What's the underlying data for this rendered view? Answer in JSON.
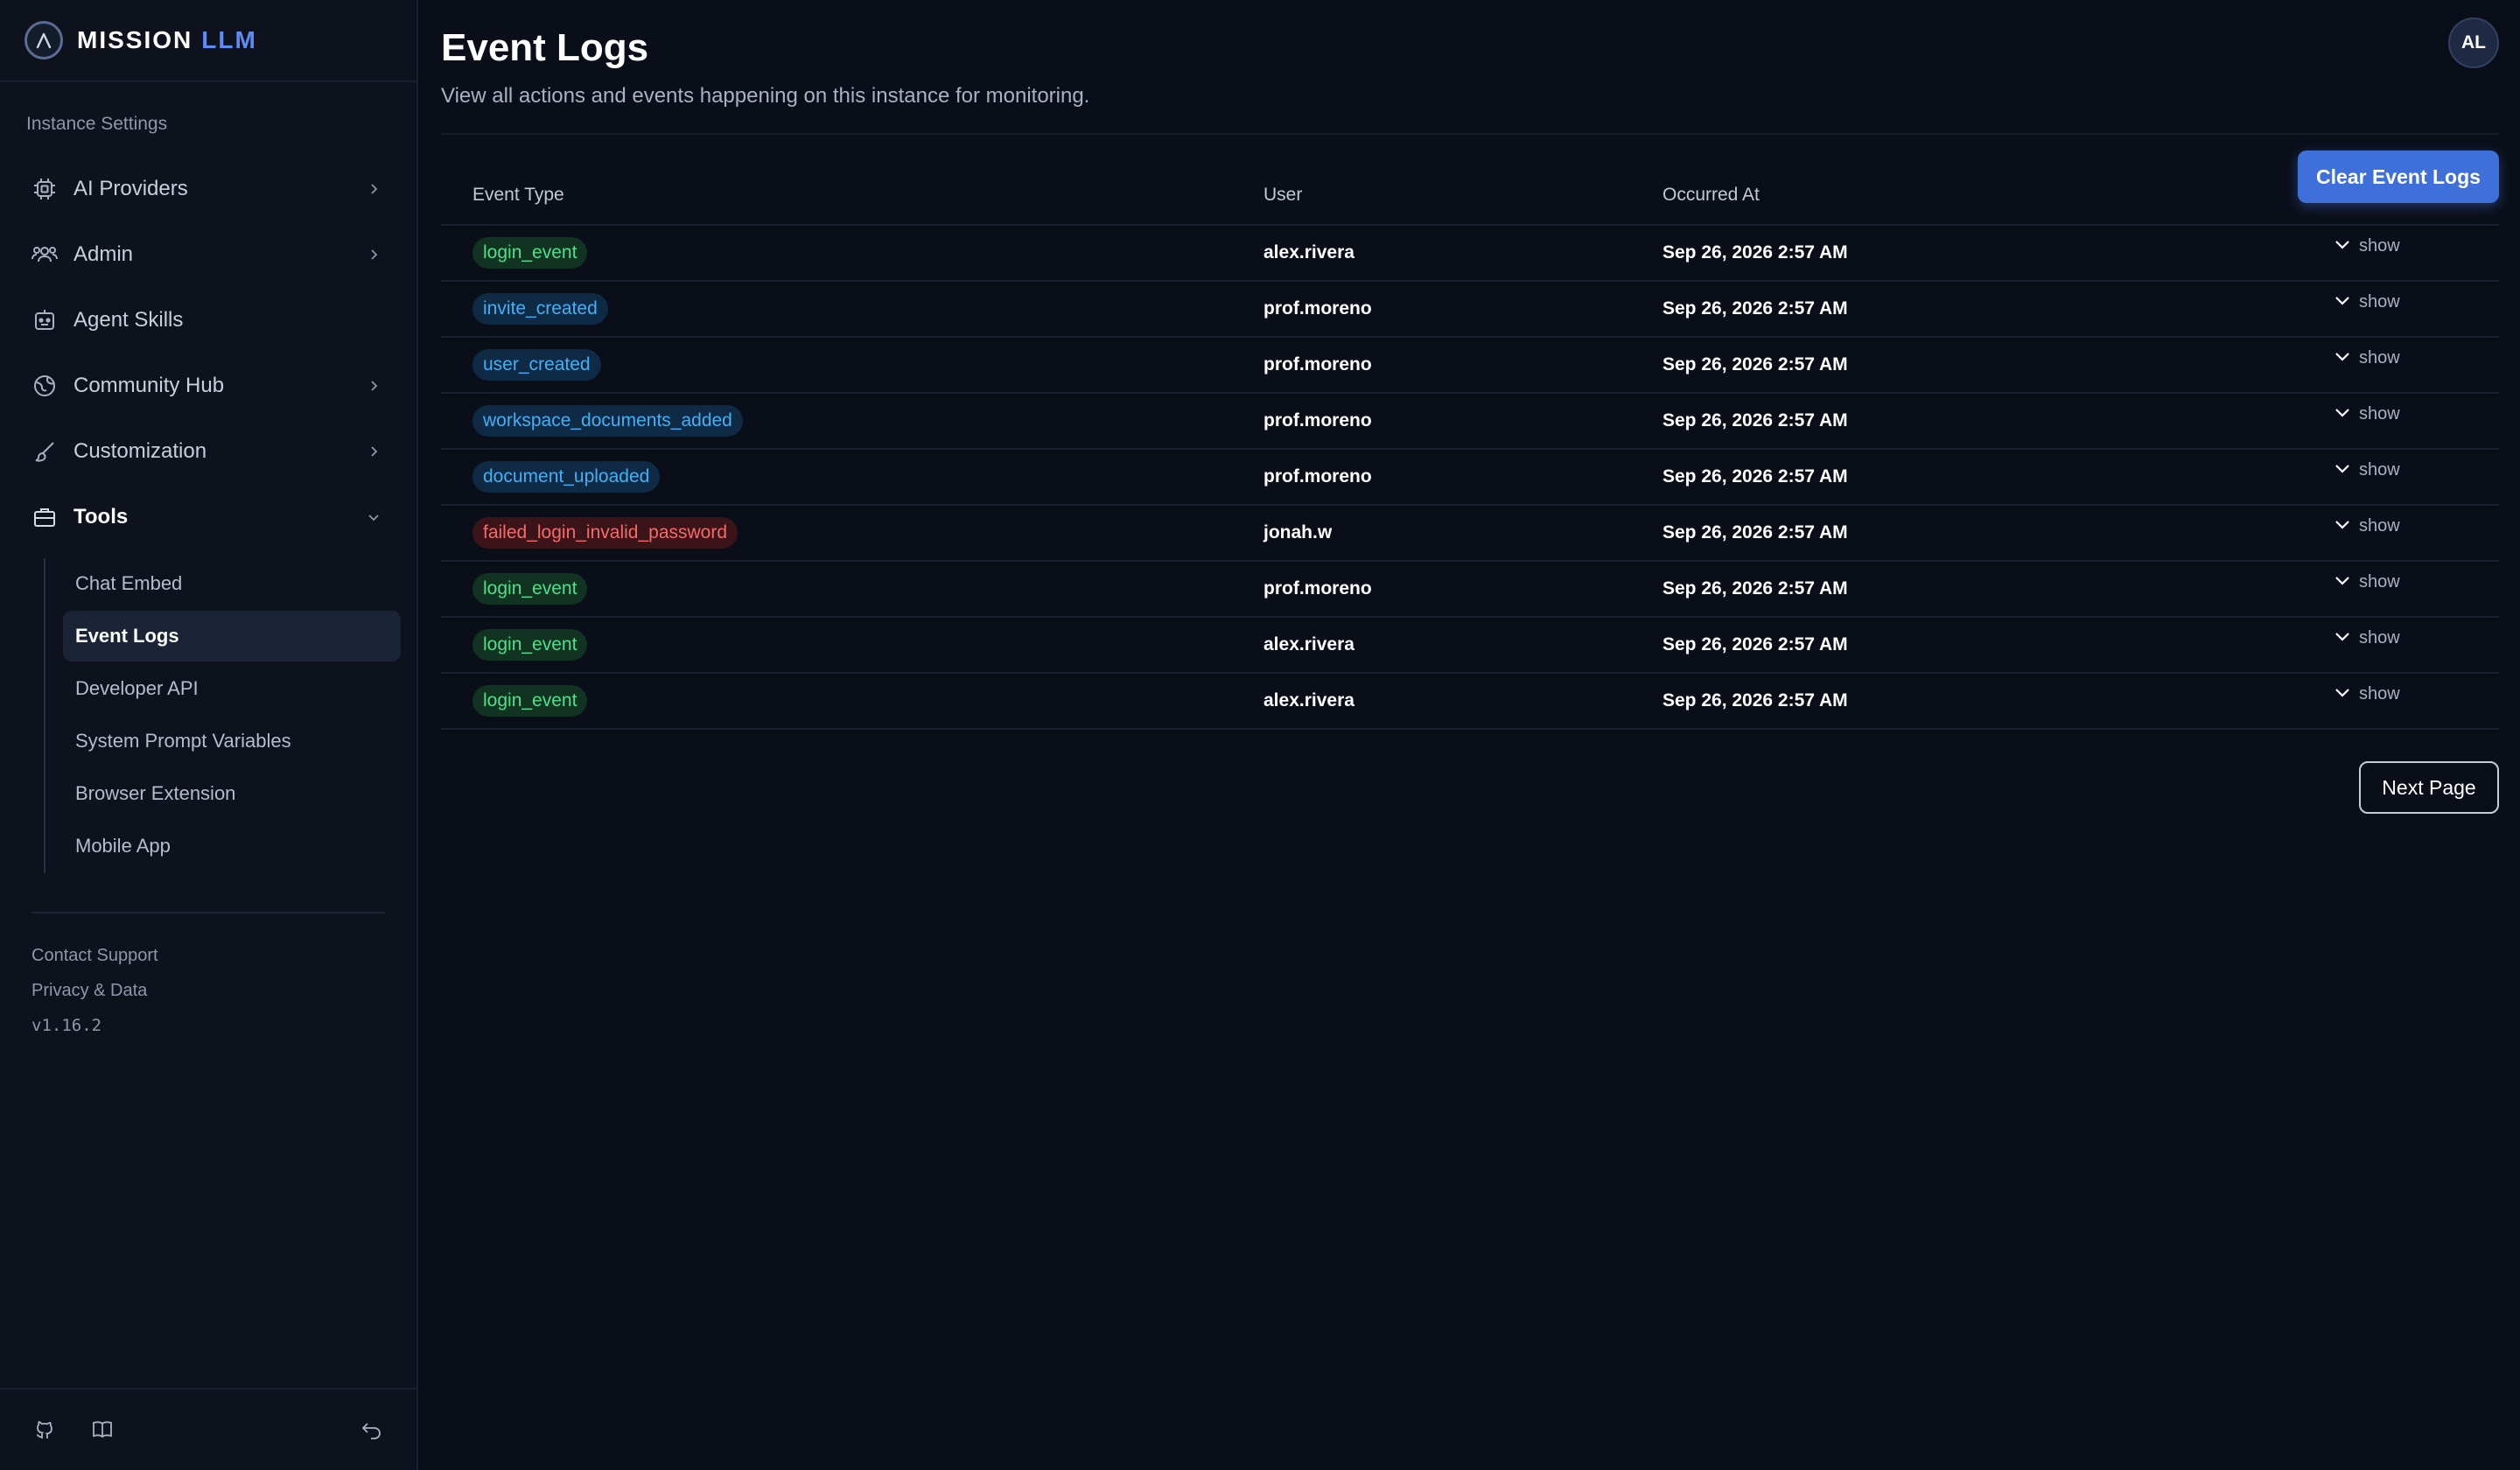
{
  "brand": {
    "name": "MISSION",
    "accent": "LLM"
  },
  "sidebar": {
    "section_label": "Instance Settings",
    "items": [
      {
        "label": "AI Providers",
        "icon": "chip-icon",
        "chevron": "right"
      },
      {
        "label": "Admin",
        "icon": "users-icon",
        "chevron": "right"
      },
      {
        "label": "Agent Skills",
        "icon": "robot-icon",
        "chevron": ""
      },
      {
        "label": "Community Hub",
        "icon": "globe-icon",
        "chevron": "right"
      },
      {
        "label": "Customization",
        "icon": "brush-icon",
        "chevron": "right"
      },
      {
        "label": "Tools",
        "icon": "toolbox-icon",
        "chevron": "down"
      }
    ],
    "sub_items": [
      {
        "label": "Chat Embed",
        "active": false
      },
      {
        "label": "Event Logs",
        "active": true
      },
      {
        "label": "Developer API",
        "active": false
      },
      {
        "label": "System Prompt Variables",
        "active": false
      },
      {
        "label": "Browser Extension",
        "active": false
      },
      {
        "label": "Mobile App",
        "active": false
      }
    ],
    "footer": {
      "contact": "Contact Support",
      "privacy": "Privacy & Data",
      "version": "v1.16.2"
    }
  },
  "header": {
    "title": "Event Logs",
    "subtitle": "View all actions and events happening on this instance for monitoring.",
    "avatar": "AL",
    "clear_button": "Clear Event Logs"
  },
  "table": {
    "columns": [
      "Event Type",
      "User",
      "Occurred At"
    ],
    "action_label": "show",
    "rows": [
      {
        "event": "login_event",
        "color": "green",
        "user": "alex.rivera",
        "time": "Sep 26, 2026 2:57 AM"
      },
      {
        "event": "invite_created",
        "color": "blue",
        "user": "prof.moreno",
        "time": "Sep 26, 2026 2:57 AM"
      },
      {
        "event": "user_created",
        "color": "blue",
        "user": "prof.moreno",
        "time": "Sep 26, 2026 2:57 AM"
      },
      {
        "event": "workspace_documents_added",
        "color": "blue",
        "user": "prof.moreno",
        "time": "Sep 26, 2026 2:57 AM"
      },
      {
        "event": "document_uploaded",
        "color": "blue",
        "user": "prof.moreno",
        "time": "Sep 26, 2026 2:57 AM"
      },
      {
        "event": "failed_login_invalid_password",
        "color": "red",
        "user": "jonah.w",
        "time": "Sep 26, 2026 2:57 AM"
      },
      {
        "event": "login_event",
        "color": "green",
        "user": "prof.moreno",
        "time": "Sep 26, 2026 2:57 AM"
      },
      {
        "event": "login_event",
        "color": "green",
        "user": "alex.rivera",
        "time": "Sep 26, 2026 2:57 AM"
      },
      {
        "event": "login_event",
        "color": "green",
        "user": "alex.rivera",
        "time": "Sep 26, 2026 2:57 AM"
      }
    ]
  },
  "pagination": {
    "next": "Next Page"
  },
  "colors": {
    "accent": "#3f6fd8",
    "background": "#0a0e18",
    "sidebar": "#0d121d"
  }
}
